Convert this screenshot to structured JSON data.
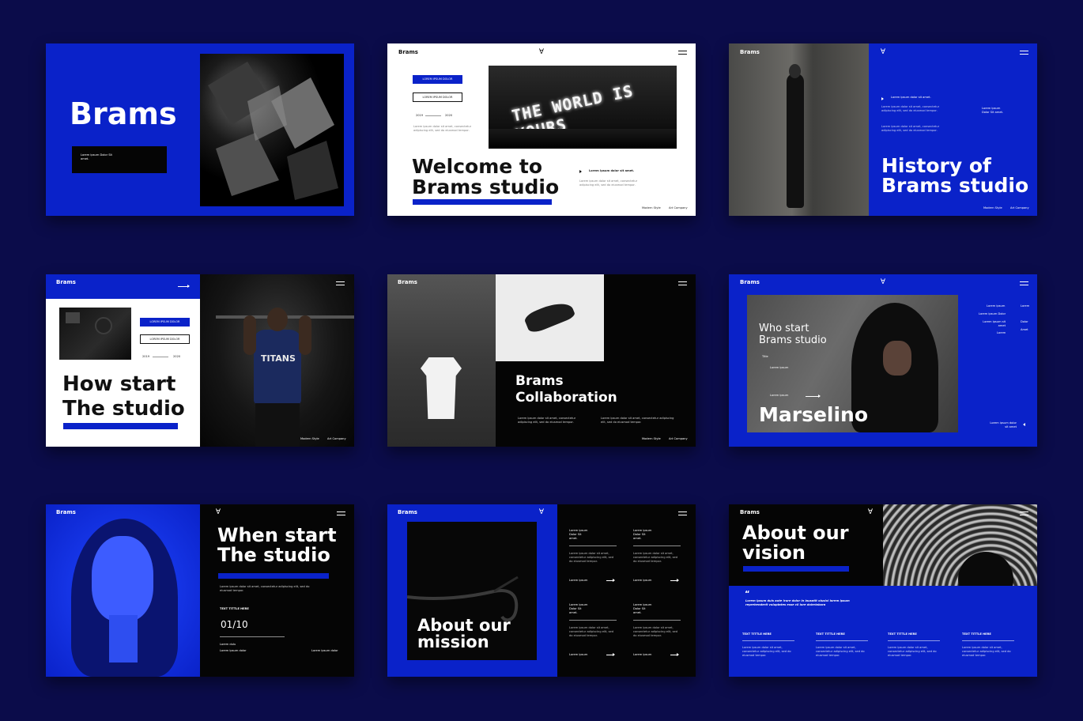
{
  "common": {
    "brand": "Brams",
    "lorem_short": "Lorem ipsum dolor sit amet.",
    "lorem_line": "Lorem ipsum dolor sit amet, consectetur adipiscing elit, sed do eiusmod tempor.",
    "lorem_stack": "Lorem ipsum Dolor Sit amet.",
    "modern_style": "Modern Style",
    "art_company": "Art Company",
    "lorem_ipsum": "Lorem ipsum",
    "text_title": "TEXT TITTLE HERE",
    "button_label": "LOREM IPSUM DOLOR",
    "year_start": "2019",
    "year_end": "2020"
  },
  "s1": {
    "title": "Brams",
    "box_text": "Lorem ipsum Dolor Sit amet."
  },
  "s2": {
    "title_line1": "Welcome to",
    "title_line2": "Brams studio",
    "neon": "THE WORLD IS YOURS"
  },
  "s3": {
    "title_line1": "History of",
    "title_line2": "Brams studio",
    "side": "Lorem ipsum Dolor Sit amet."
  },
  "s4": {
    "title_line1": "How start",
    "title_line2": "The studio",
    "jersey": "TITANS"
  },
  "s5": {
    "title_line1": "Brams",
    "title_line2": "Collaboration"
  },
  "s6": {
    "title_line1": "Who start",
    "title_line2": "Brams studio",
    "tag": "Title",
    "name": "Marselino",
    "menu": [
      "Lorem ipsum",
      "Lorem ipsum Dolor",
      "Lorem ipsum sit amet",
      "Lorem"
    ],
    "menu_right": [
      "Lorem",
      "Dolor",
      "Amet"
    ],
    "bottom": "Lorem ipsum dolor sit amet"
  },
  "s7": {
    "title_line1": "When start",
    "title_line2": "The studio",
    "counter": "01/10",
    "label": "Lorem dulu",
    "sub": "Lorem ipsum dolor"
  },
  "s8": {
    "title_line1": "About our",
    "title_line2": "mission"
  },
  "s9": {
    "title_line1": "About our",
    "title_line2": "vision",
    "quote_mark": "“",
    "quote": "Lorem ipsum duis aute irure dolor in lausatit olusixi lorem ipsum reprehenderit voluptates esse cil lore dolerlabora"
  }
}
